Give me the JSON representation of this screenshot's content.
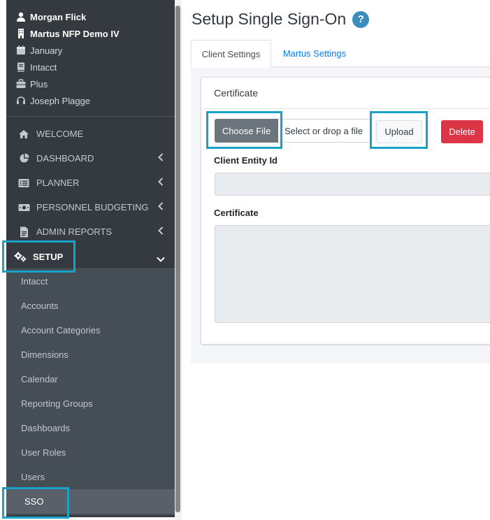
{
  "sidebar": {
    "user": [
      {
        "icon": "user-icon",
        "text": "Morgan Flick"
      },
      {
        "icon": "building-icon",
        "text": "Martus NFP Demo IV"
      },
      {
        "icon": "calendar-icon",
        "text": "January"
      },
      {
        "icon": "book-icon",
        "text": "Intacct"
      },
      {
        "icon": "briefcase-icon",
        "text": "Plus"
      },
      {
        "icon": "headset-icon",
        "text": "Joseph Plagge"
      }
    ],
    "nav": [
      {
        "icon": "home-icon",
        "label": "WELCOME"
      },
      {
        "icon": "pie-chart-icon",
        "label": "DASHBOARD"
      },
      {
        "icon": "list-icon",
        "label": "PLANNER"
      },
      {
        "icon": "money-icon",
        "label": "PERSONNEL BUDGETING"
      },
      {
        "icon": "report-icon",
        "label": "ADMIN REPORTS"
      }
    ],
    "setup": {
      "icon": "cogs-icon",
      "label": "SETUP"
    },
    "setup_items": [
      "Intacct",
      "Accounts",
      "Account Categories",
      "Dimensions",
      "Calendar",
      "Reporting Groups",
      "Dashboards",
      "User Roles",
      "Users",
      "SSO"
    ]
  },
  "main": {
    "title": "Setup Single Sign-On",
    "help": "?",
    "tabs": [
      "Client Settings",
      "Martus Settings"
    ],
    "card": {
      "header": "Certificate",
      "choose_file": "Choose File",
      "file_placeholder": "Select or drop a file",
      "upload": "Upload",
      "delete": "Delete",
      "client_entity_label": "Client Entity Id",
      "certificate_label": "Certificate"
    }
  },
  "colors": {
    "sidebar": "#343a40",
    "sidebar_sub": "#454d55",
    "highlight": "#17a2c7",
    "link": "#007bff",
    "danger": "#dc3545",
    "secondary": "#6c757d",
    "help": "#3c8dbc"
  }
}
